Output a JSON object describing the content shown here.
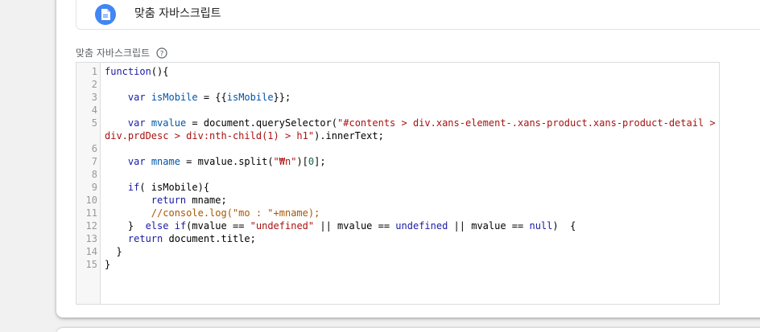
{
  "variable_type": {
    "icon": "document-icon",
    "label": "맞춤 자바스크립트"
  },
  "field": {
    "label": "맞춤 자바스크립트",
    "help_icon": "help-icon"
  },
  "editor": {
    "lines": [
      {
        "number": "1",
        "tokens": [
          {
            "t": "kw",
            "v": "function"
          },
          {
            "t": "ident",
            "v": "(){"
          }
        ]
      },
      {
        "number": "2",
        "tokens": []
      },
      {
        "number": "3",
        "tokens": [
          {
            "t": "ident",
            "v": "    "
          },
          {
            "t": "kw",
            "v": "var"
          },
          {
            "t": "ident",
            "v": " "
          },
          {
            "t": "var",
            "v": "isMobile"
          },
          {
            "t": "ident",
            "v": " = {{"
          },
          {
            "t": "var",
            "v": "isMobile"
          },
          {
            "t": "ident",
            "v": "}};"
          }
        ]
      },
      {
        "number": "4",
        "tokens": []
      },
      {
        "number": "5",
        "tokens": [
          {
            "t": "ident",
            "v": "    "
          },
          {
            "t": "kw",
            "v": "var"
          },
          {
            "t": "ident",
            "v": " "
          },
          {
            "t": "var",
            "v": "mvalue"
          },
          {
            "t": "ident",
            "v": " = document.querySelector("
          },
          {
            "t": "str",
            "v": "\"#contents > div.xans-element-.xans-product.xans-product-detail >"
          }
        ]
      },
      {
        "number": "",
        "tokens": [
          {
            "t": "str",
            "v": "div.prdDesc > div:nth-child(1) > h1\""
          },
          {
            "t": "ident",
            "v": ").innerText;"
          }
        ]
      },
      {
        "number": "6",
        "tokens": []
      },
      {
        "number": "7",
        "tokens": [
          {
            "t": "ident",
            "v": "    "
          },
          {
            "t": "kw",
            "v": "var"
          },
          {
            "t": "ident",
            "v": " "
          },
          {
            "t": "var",
            "v": "mname"
          },
          {
            "t": "ident",
            "v": " = mvalue.split("
          },
          {
            "t": "str",
            "v": "\"₩n\""
          },
          {
            "t": "ident",
            "v": ")["
          },
          {
            "t": "num",
            "v": "0"
          },
          {
            "t": "ident",
            "v": "];"
          }
        ]
      },
      {
        "number": "8",
        "tokens": []
      },
      {
        "number": "9",
        "tokens": [
          {
            "t": "ident",
            "v": "    "
          },
          {
            "t": "kw",
            "v": "if"
          },
          {
            "t": "ident",
            "v": "( isMobile){"
          }
        ]
      },
      {
        "number": "10",
        "tokens": [
          {
            "t": "ident",
            "v": "        "
          },
          {
            "t": "kw",
            "v": "return"
          },
          {
            "t": "ident",
            "v": " mname;"
          }
        ]
      },
      {
        "number": "11",
        "tokens": [
          {
            "t": "ident",
            "v": "        "
          },
          {
            "t": "com",
            "v": "//console.log(\"mo : \"+mname);"
          }
        ]
      },
      {
        "number": "12",
        "tokens": [
          {
            "t": "ident",
            "v": "    }  "
          },
          {
            "t": "kw",
            "v": "else"
          },
          {
            "t": "ident",
            "v": " "
          },
          {
            "t": "kw",
            "v": "if"
          },
          {
            "t": "ident",
            "v": "(mvalue == "
          },
          {
            "t": "str",
            "v": "\"undefined\""
          },
          {
            "t": "ident",
            "v": " || mvalue == "
          },
          {
            "t": "kw",
            "v": "undefined"
          },
          {
            "t": "ident",
            "v": " || mvalue == "
          },
          {
            "t": "kw",
            "v": "null"
          },
          {
            "t": "ident",
            "v": ")  {"
          }
        ]
      },
      {
        "number": "13",
        "tokens": [
          {
            "t": "ident",
            "v": "    "
          },
          {
            "t": "kw",
            "v": "return"
          },
          {
            "t": "ident",
            "v": " document.title;"
          }
        ]
      },
      {
        "number": "14",
        "tokens": [
          {
            "t": "ident",
            "v": "  }"
          }
        ]
      },
      {
        "number": "15",
        "tokens": [
          {
            "t": "ident",
            "v": "}"
          }
        ]
      }
    ]
  }
}
